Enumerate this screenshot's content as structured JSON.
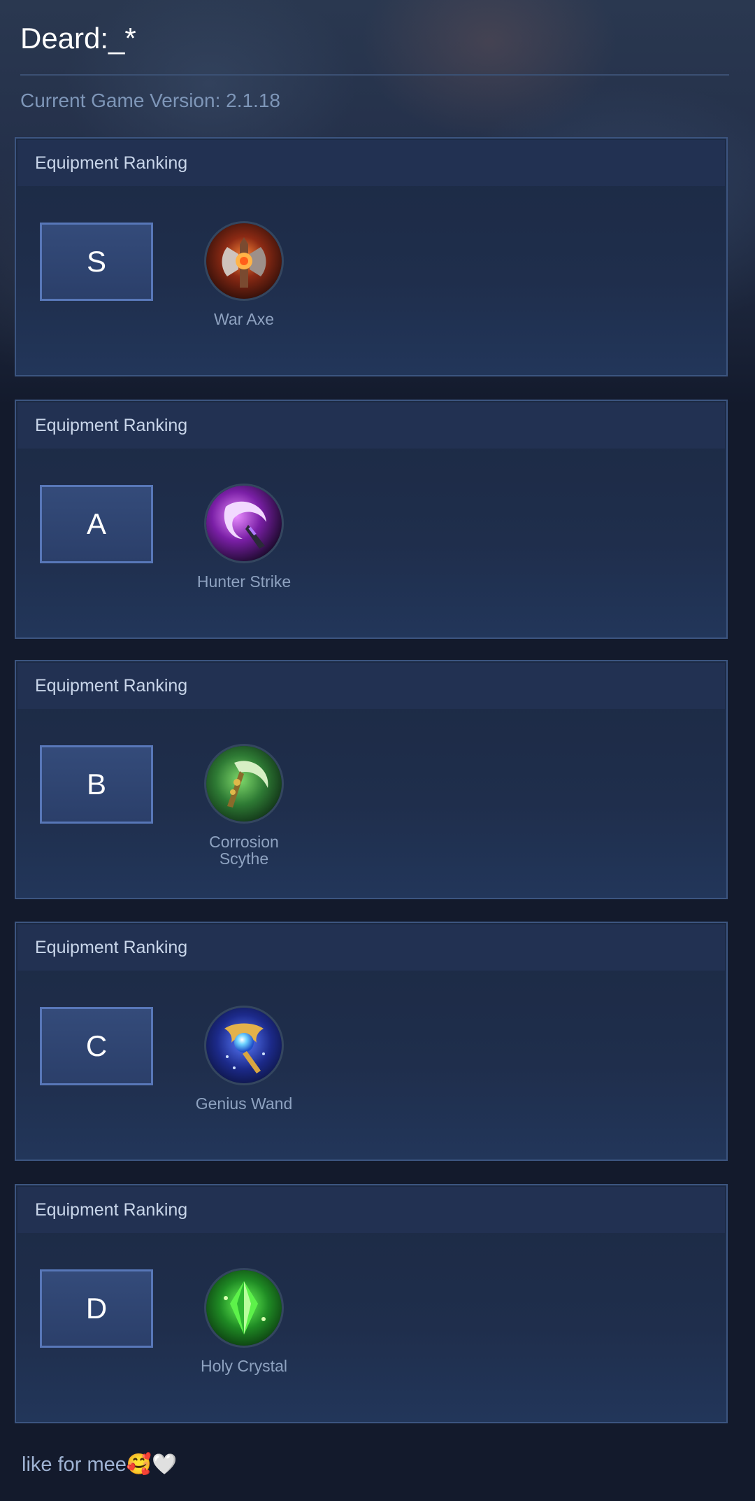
{
  "header": {
    "title": "Deard:_*",
    "version_text": "Current Game Version: 2.1.18"
  },
  "rankings": [
    {
      "heading": "Equipment Ranking",
      "tier": "S",
      "item_name": "War Axe",
      "icon": "war-axe-icon"
    },
    {
      "heading": "Equipment Ranking",
      "tier": "A",
      "item_name": "Hunter Strike",
      "icon": "hunter-strike-icon"
    },
    {
      "heading": "Equipment Ranking",
      "tier": "B",
      "item_name": "Corrosion Scythe",
      "icon": "corrosion-scythe-icon"
    },
    {
      "heading": "Equipment Ranking",
      "tier": "C",
      "item_name": "Genius Wand",
      "icon": "genius-wand-icon"
    },
    {
      "heading": "Equipment Ranking",
      "tier": "D",
      "item_name": "Holy Crystal",
      "icon": "holy-crystal-icon"
    }
  ],
  "footer": {
    "text": "like for mee🥰🤍"
  },
  "colors": {
    "background": "#131a2c",
    "card_border": "#3c5580",
    "tier_border": "#5877b8"
  }
}
